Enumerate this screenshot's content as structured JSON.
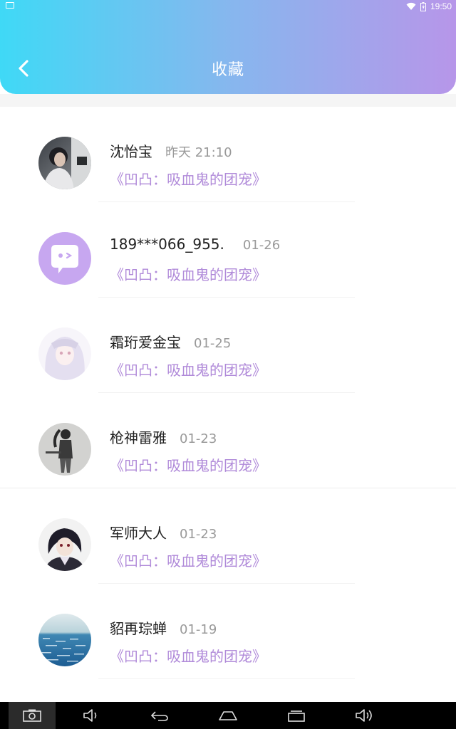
{
  "status_bar": {
    "time": "19:50",
    "icons": [
      "notification-icon",
      "wifi-icon",
      "battery-icon"
    ]
  },
  "header": {
    "title": "收藏",
    "back_icon": "chevron-left-icon"
  },
  "colors": {
    "gradient_start": "#3fd9f6",
    "gradient_end": "#b796e9",
    "book_text": "#b08ad9",
    "time_text": "#999999"
  },
  "favorites": [
    {
      "name": "沈怡宝",
      "time": "昨天 21:10",
      "book": "《凹凸：吸血鬼的团宠》",
      "avatar": "photo-avatar"
    },
    {
      "name": "189***066_955.",
      "time": "01-26",
      "book": "《凹凸：吸血鬼的团宠》",
      "avatar": "chat-bubble-avatar"
    },
    {
      "name": "霜珩爱金宝",
      "time": "01-25",
      "book": "《凹凸：吸血鬼的团宠》",
      "avatar": "anime-white-hair-avatar"
    },
    {
      "name": "枪神雷雅",
      "time": "01-23",
      "book": "《凹凸：吸血鬼的团宠》",
      "avatar": "anime-gunner-avatar"
    },
    {
      "name": "军师大人",
      "time": "01-23",
      "book": "《凹凸：吸血鬼的团宠》",
      "avatar": "anime-dark-hair-avatar"
    },
    {
      "name": "貂再琮蝉",
      "time": "01-19",
      "book": "《凹凸：吸血鬼的团宠》",
      "avatar": "sea-photo-avatar"
    }
  ],
  "nav_bar": {
    "icons": [
      "screenshot-icon",
      "volume-down-icon",
      "back-icon",
      "home-icon",
      "recents-icon",
      "volume-up-icon"
    ]
  }
}
